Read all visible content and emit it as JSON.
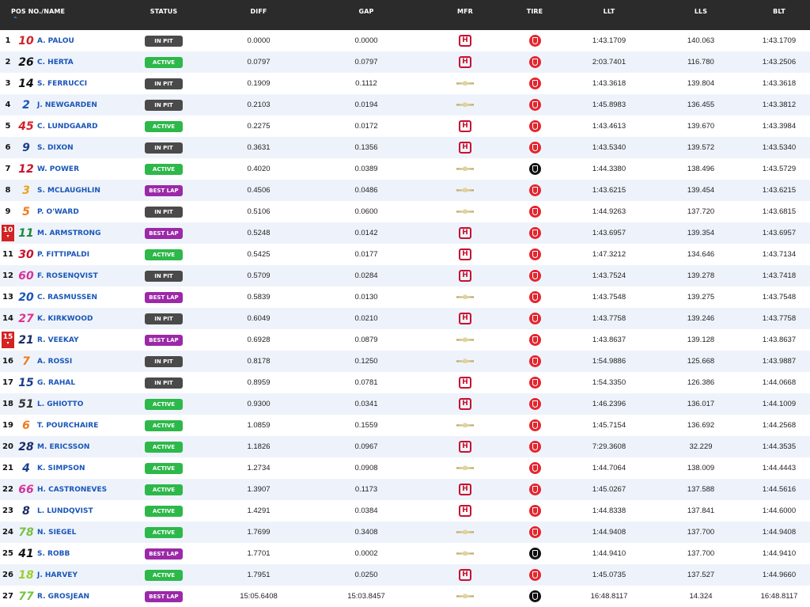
{
  "header": {
    "pos_name": "POS NO./NAME",
    "status": "STATUS",
    "diff": "DIFF",
    "gap": "GAP",
    "mfr": "MFR",
    "tire": "TIRE",
    "llt": "LLT",
    "lls": "LLS",
    "blt": "BLT",
    "sort_icon": "sort-caret-up-icon"
  },
  "colors": {
    "in_pit": "#4a4a4a",
    "active": "#2db84a",
    "best_lap": "#9b29a8",
    "tire_red": "#e3262f",
    "tire_black": "#111111",
    "honda": "#c8102e",
    "name": "#1a56b8",
    "position_flag": "#d42121"
  },
  "rows": [
    {
      "pos": "1",
      "flag": false,
      "num": "10",
      "num_color": "#d4202a",
      "name": "A. PALOU",
      "status": "IN PIT",
      "status_type": "in_pit",
      "diff": "0.0000",
      "gap": "0.0000",
      "mfr": "honda",
      "tire": "red",
      "llt": "1:43.1709",
      "lls": "140.063",
      "blt": "1:43.1709"
    },
    {
      "pos": "2",
      "flag": false,
      "num": "26",
      "num_color": "#111111",
      "name": "C. HERTA",
      "status": "ACTIVE",
      "status_type": "active",
      "diff": "0.0797",
      "gap": "0.0797",
      "mfr": "honda",
      "tire": "red",
      "llt": "2:03.7401",
      "lls": "116.780",
      "blt": "1:43.2506"
    },
    {
      "pos": "3",
      "flag": false,
      "num": "14",
      "num_color": "#111111",
      "name": "S. FERRUCCI",
      "status": "IN PIT",
      "status_type": "in_pit",
      "diff": "0.1909",
      "gap": "0.1112",
      "mfr": "chevrolet",
      "tire": "red",
      "llt": "1:43.3618",
      "lls": "139.804",
      "blt": "1:43.3618"
    },
    {
      "pos": "4",
      "flag": false,
      "num": "2",
      "num_color": "#1a56b8",
      "name": "J. NEWGARDEN",
      "status": "IN PIT",
      "status_type": "in_pit",
      "diff": "0.2103",
      "gap": "0.0194",
      "mfr": "chevrolet",
      "tire": "red",
      "llt": "1:45.8983",
      "lls": "136.455",
      "blt": "1:43.3812"
    },
    {
      "pos": "5",
      "flag": false,
      "num": "45",
      "num_color": "#d4202a",
      "name": "C. LUNDGAARD",
      "status": "ACTIVE",
      "status_type": "active",
      "diff": "0.2275",
      "gap": "0.0172",
      "mfr": "honda",
      "tire": "red",
      "llt": "1:43.4613",
      "lls": "139.670",
      "blt": "1:43.3984"
    },
    {
      "pos": "6",
      "flag": false,
      "num": "9",
      "num_color": "#1a3d8f",
      "name": "S. DIXON",
      "status": "IN PIT",
      "status_type": "in_pit",
      "diff": "0.3631",
      "gap": "0.1356",
      "mfr": "honda",
      "tire": "red",
      "llt": "1:43.5340",
      "lls": "139.572",
      "blt": "1:43.5340"
    },
    {
      "pos": "7",
      "flag": false,
      "num": "12",
      "num_color": "#c8102e",
      "name": "W. POWER",
      "status": "ACTIVE",
      "status_type": "active",
      "diff": "0.4020",
      "gap": "0.0389",
      "mfr": "chevrolet",
      "tire": "black",
      "llt": "1:44.3380",
      "lls": "138.496",
      "blt": "1:43.5729"
    },
    {
      "pos": "8",
      "flag": false,
      "num": "3",
      "num_color": "#e5a31a",
      "name": "S. MCLAUGHLIN",
      "status": "BEST LAP",
      "status_type": "best_lap",
      "diff": "0.4506",
      "gap": "0.0486",
      "mfr": "chevrolet",
      "tire": "red",
      "llt": "1:43.6215",
      "lls": "139.454",
      "blt": "1:43.6215"
    },
    {
      "pos": "9",
      "flag": false,
      "num": "5",
      "num_color": "#f07a1a",
      "name": "P. O'WARD",
      "status": "IN PIT",
      "status_type": "in_pit",
      "diff": "0.5106",
      "gap": "0.0600",
      "mfr": "chevrolet",
      "tire": "red",
      "llt": "1:44.9263",
      "lls": "137.720",
      "blt": "1:43.6815"
    },
    {
      "pos": "10",
      "flag": true,
      "num": "11",
      "num_color": "#1a8a3a",
      "name": "M. ARMSTRONG",
      "status": "BEST LAP",
      "status_type": "best_lap",
      "diff": "0.5248",
      "gap": "0.0142",
      "mfr": "honda",
      "tire": "red",
      "llt": "1:43.6957",
      "lls": "139.354",
      "blt": "1:43.6957"
    },
    {
      "pos": "11",
      "flag": false,
      "num": "30",
      "num_color": "#c8102e",
      "name": "P. FITTIPALDI",
      "status": "ACTIVE",
      "status_type": "active",
      "diff": "0.5425",
      "gap": "0.0177",
      "mfr": "honda",
      "tire": "red",
      "llt": "1:47.3212",
      "lls": "134.646",
      "blt": "1:43.7134"
    },
    {
      "pos": "12",
      "flag": false,
      "num": "60",
      "num_color": "#d6339a",
      "name": "F. ROSENQVIST",
      "status": "IN PIT",
      "status_type": "in_pit",
      "diff": "0.5709",
      "gap": "0.0284",
      "mfr": "honda",
      "tire": "red",
      "llt": "1:43.7524",
      "lls": "139.278",
      "blt": "1:43.7418"
    },
    {
      "pos": "13",
      "flag": false,
      "num": "20",
      "num_color": "#1a56b8",
      "name": "C. RASMUSSEN",
      "status": "BEST LAP",
      "status_type": "best_lap",
      "diff": "0.5839",
      "gap": "0.0130",
      "mfr": "chevrolet",
      "tire": "red",
      "llt": "1:43.7548",
      "lls": "139.275",
      "blt": "1:43.7548"
    },
    {
      "pos": "14",
      "flag": false,
      "num": "27",
      "num_color": "#e0338f",
      "name": "K. KIRKWOOD",
      "status": "IN PIT",
      "status_type": "in_pit",
      "diff": "0.6049",
      "gap": "0.0210",
      "mfr": "honda",
      "tire": "red",
      "llt": "1:43.7758",
      "lls": "139.246",
      "blt": "1:43.7758"
    },
    {
      "pos": "15",
      "flag": true,
      "num": "21",
      "num_color": "#1a2d6b",
      "name": "R. VEEKAY",
      "status": "BEST LAP",
      "status_type": "best_lap",
      "diff": "0.6928",
      "gap": "0.0879",
      "mfr": "chevrolet",
      "tire": "red",
      "llt": "1:43.8637",
      "lls": "139.128",
      "blt": "1:43.8637"
    },
    {
      "pos": "16",
      "flag": false,
      "num": "7",
      "num_color": "#f07a1a",
      "name": "A. ROSSI",
      "status": "IN PIT",
      "status_type": "in_pit",
      "diff": "0.8178",
      "gap": "0.1250",
      "mfr": "chevrolet",
      "tire": "red",
      "llt": "1:54.9886",
      "lls": "125.668",
      "blt": "1:43.9887"
    },
    {
      "pos": "17",
      "flag": false,
      "num": "15",
      "num_color": "#1a3d8f",
      "name": "G. RAHAL",
      "status": "IN PIT",
      "status_type": "in_pit",
      "diff": "0.8959",
      "gap": "0.0781",
      "mfr": "honda",
      "tire": "red",
      "llt": "1:54.3350",
      "lls": "126.386",
      "blt": "1:44.0668"
    },
    {
      "pos": "18",
      "flag": false,
      "num": "51",
      "num_color": "#333333",
      "name": "L. GHIOTTO",
      "status": "ACTIVE",
      "status_type": "active",
      "diff": "0.9300",
      "gap": "0.0341",
      "mfr": "honda",
      "tire": "red",
      "llt": "1:46.2396",
      "lls": "136.017",
      "blt": "1:44.1009"
    },
    {
      "pos": "19",
      "flag": false,
      "num": "6",
      "num_color": "#f07a1a",
      "name": "T. POURCHAIRE",
      "status": "ACTIVE",
      "status_type": "active",
      "diff": "1.0859",
      "gap": "0.1559",
      "mfr": "chevrolet",
      "tire": "red",
      "llt": "1:45.7154",
      "lls": "136.692",
      "blt": "1:44.2568"
    },
    {
      "pos": "20",
      "flag": false,
      "num": "28",
      "num_color": "#1a2d6b",
      "name": "M. ERICSSON",
      "status": "ACTIVE",
      "status_type": "active",
      "diff": "1.1826",
      "gap": "0.0967",
      "mfr": "honda",
      "tire": "red",
      "llt": "7:29.3608",
      "lls": "32.229",
      "blt": "1:44.3535"
    },
    {
      "pos": "21",
      "flag": false,
      "num": "4",
      "num_color": "#1a3d8f",
      "name": "K. SIMPSON",
      "status": "ACTIVE",
      "status_type": "active",
      "diff": "1.2734",
      "gap": "0.0908",
      "mfr": "chevrolet",
      "tire": "red",
      "llt": "1:44.7064",
      "lls": "138.009",
      "blt": "1:44.4443"
    },
    {
      "pos": "22",
      "flag": false,
      "num": "66",
      "num_color": "#d6339a",
      "name": "H. CASTRONEVES",
      "status": "ACTIVE",
      "status_type": "active",
      "diff": "1.3907",
      "gap": "0.1173",
      "mfr": "honda",
      "tire": "red",
      "llt": "1:45.0267",
      "lls": "137.588",
      "blt": "1:44.5616"
    },
    {
      "pos": "23",
      "flag": false,
      "num": "8",
      "num_color": "#1a2d6b",
      "name": "L. LUNDQVIST",
      "status": "ACTIVE",
      "status_type": "active",
      "diff": "1.4291",
      "gap": "0.0384",
      "mfr": "honda",
      "tire": "red",
      "llt": "1:44.8338",
      "lls": "137.841",
      "blt": "1:44.6000"
    },
    {
      "pos": "24",
      "flag": false,
      "num": "78",
      "num_color": "#7ac143",
      "name": "N. SIEGEL",
      "status": "ACTIVE",
      "status_type": "active",
      "diff": "1.7699",
      "gap": "0.3408",
      "mfr": "chevrolet",
      "tire": "red",
      "llt": "1:44.9408",
      "lls": "137.700",
      "blt": "1:44.9408"
    },
    {
      "pos": "25",
      "flag": false,
      "num": "41",
      "num_color": "#111111",
      "name": "S. ROBB",
      "status": "BEST LAP",
      "status_type": "best_lap",
      "diff": "1.7701",
      "gap": "0.0002",
      "mfr": "chevrolet",
      "tire": "black",
      "llt": "1:44.9410",
      "lls": "137.700",
      "blt": "1:44.9410"
    },
    {
      "pos": "26",
      "flag": false,
      "num": "18",
      "num_color": "#9ad12a",
      "name": "J. HARVEY",
      "status": "ACTIVE",
      "status_type": "active",
      "diff": "1.7951",
      "gap": "0.0250",
      "mfr": "honda",
      "tire": "red",
      "llt": "1:45.0735",
      "lls": "137.527",
      "blt": "1:44.9660"
    },
    {
      "pos": "27",
      "flag": false,
      "num": "77",
      "num_color": "#7ac143",
      "name": "R. GROSJEAN",
      "status": "BEST LAP",
      "status_type": "best_lap",
      "diff": "15:05.6408",
      "gap": "15:03.8457",
      "mfr": "chevrolet",
      "tire": "black",
      "llt": "16:48.8117",
      "lls": "14.324",
      "blt": "16:48.8117"
    }
  ]
}
